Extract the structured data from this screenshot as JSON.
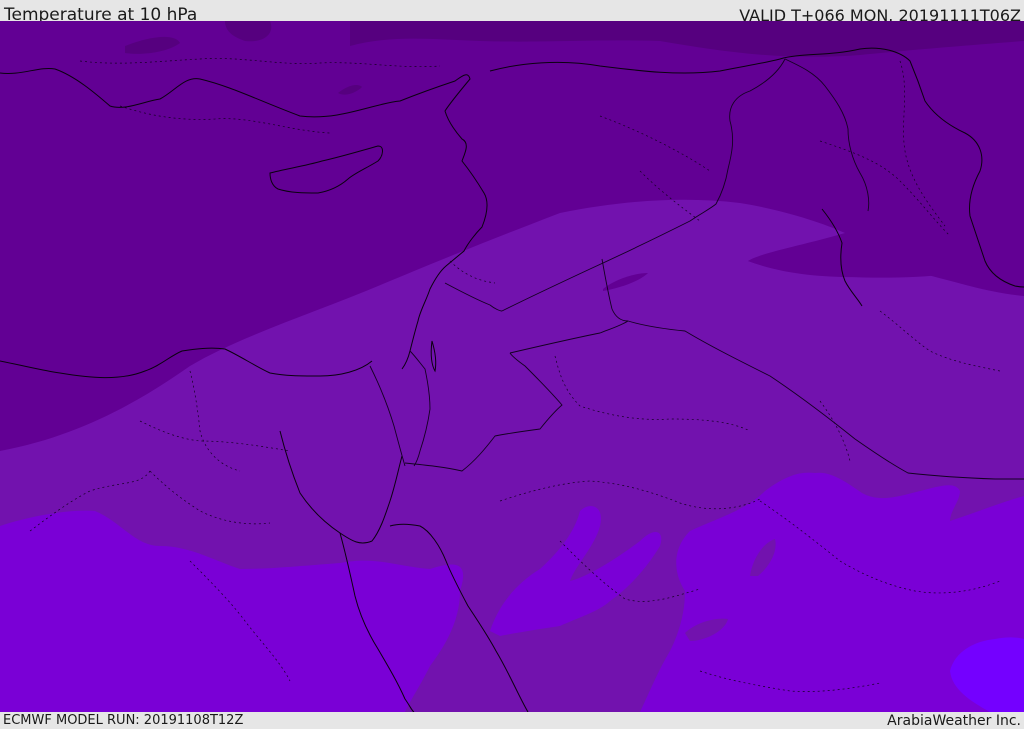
{
  "header": {
    "title": "Temperature at 10 hPa",
    "valid": "VALID T+066 MON. 20191111T06Z"
  },
  "footer": {
    "model_run": "ECMWF MODEL RUN: 20191108T12Z",
    "credit": "ArabiaWeather Inc."
  },
  "map": {
    "field": "temperature",
    "level": "10 hPa",
    "colors": {
      "darkest": "#56007f",
      "dark": "#620094",
      "mid": "#7212ae",
      "bright": "#7a00d6",
      "brightest": "#7400ff",
      "coastline": "#0b0010",
      "border": "#140022"
    },
    "shading_bands": [
      "darkest",
      "dark",
      "mid",
      "bright",
      "brightest"
    ]
  }
}
